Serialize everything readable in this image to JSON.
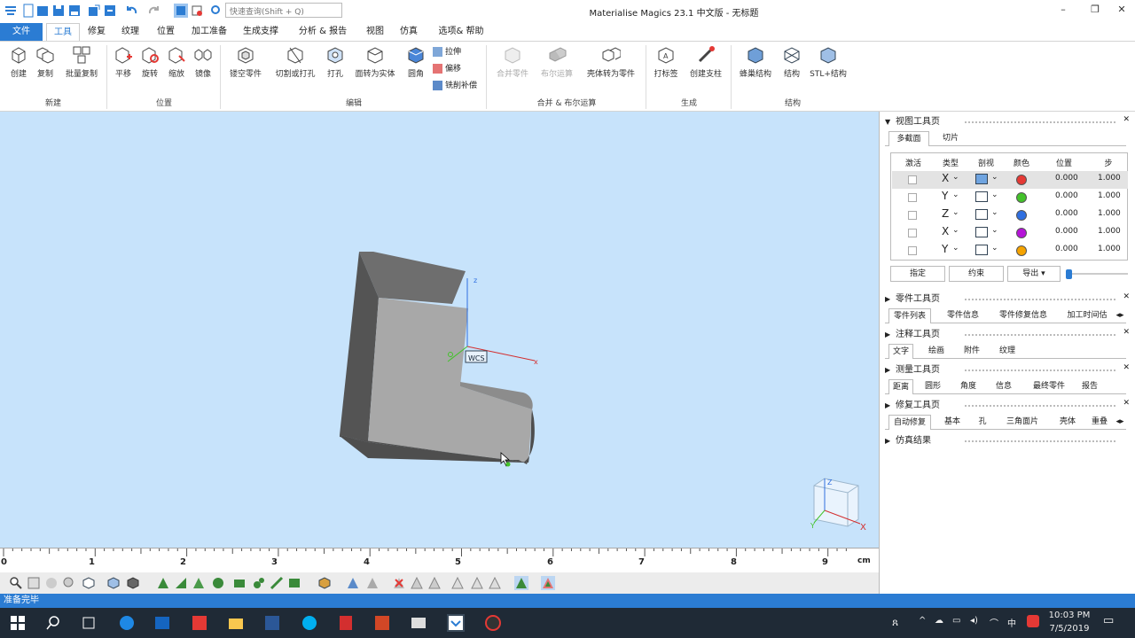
{
  "app": {
    "title": "Materialise Magics 23.1 中文版 - 无标题",
    "search_placeholder": "快速查询(Shift + Q)"
  },
  "ribbon_tabs": [
    "文件",
    "工具",
    "修复",
    "纹理",
    "位置",
    "加工准备",
    "生成支撑",
    "分析 & 报告",
    "视图",
    "仿真",
    "选项& 帮助"
  ],
  "ribbon": {
    "create": "创建",
    "copy": "复制",
    "batch_copy": "批量复制",
    "group_new": "新建",
    "translate": "平移",
    "rotate": "旋转",
    "scale": "缩放",
    "mirror": "镜像",
    "group_position": "位置",
    "hollow": "镂空零件",
    "cut_punch": "切割或打孔",
    "perforate": "打孔",
    "surface_to_solid": "面转为实体",
    "fillet": "圆角",
    "extrude": "拉伸",
    "offset": "偏移",
    "mill_comp": "铣削补偿",
    "group_edit": "编辑",
    "merge_parts": "合并零件",
    "boolean": "布尔运算",
    "shell_to_part": "壳体转为零件",
    "group_merge": "合并 & 布尔运算",
    "label": "打标签",
    "create_support": "创建支柱",
    "group_generate": "生成",
    "honeycomb": "蜂巢结构",
    "structure": "结构",
    "stl_structure": "STL+结构",
    "group_structure": "结构"
  },
  "viewport": {
    "wcs": "WCS",
    "z": "z",
    "x": "x",
    "ruler": [
      "0",
      "1",
      "2",
      "3",
      "4",
      "5",
      "6",
      "7",
      "8",
      "9"
    ],
    "unit": "cm"
  },
  "colors": {
    "accent": "#2b7cd3",
    "viewport_bg": "#c7e3fb",
    "part_front": "#a6a6a6",
    "part_side": "#5a5a5a",
    "part_top": "#6e6e6e"
  },
  "view_pages": {
    "title": "视图工具页",
    "tabs": [
      "多截面",
      "切片"
    ],
    "headers": [
      "激活",
      "类型",
      "剖视",
      "颜色",
      "位置",
      "步"
    ],
    "rows": [
      {
        "type": "X",
        "color": "#e53935",
        "pos": "0.000",
        "step": "1.000"
      },
      {
        "type": "Y",
        "color": "#43c22a",
        "pos": "0.000",
        "step": "1.000"
      },
      {
        "type": "Z",
        "color": "#2f6fe0",
        "pos": "0.000",
        "step": "1.000"
      },
      {
        "type": "X",
        "color": "#b514d8",
        "pos": "0.000",
        "step": "1.000"
      },
      {
        "type": "Y",
        "color": "#f5a300",
        "pos": "0.000",
        "step": "1.000"
      }
    ],
    "btn_assign": "指定",
    "btn_constraint": "约束",
    "btn_export": "导出"
  },
  "part_pages": {
    "title": "零件工具页",
    "tabs": [
      "零件列表",
      "零件信息",
      "零件修复信息",
      "加工时间估"
    ]
  },
  "annot_pages": {
    "title": "注释工具页",
    "tabs": [
      "文字",
      "绘画",
      "附件",
      "纹理"
    ]
  },
  "measure_pages": {
    "title": "测量工具页",
    "tabs": [
      "距离",
      "圆形",
      "角度",
      "信息",
      "最终零件",
      "报告"
    ]
  },
  "fix_pages": {
    "title": "修复工具页",
    "tabs": [
      "自动修复",
      "基本",
      "孔",
      "三角面片",
      "壳体",
      "重叠"
    ]
  },
  "sim_results": "仿真结果",
  "status": "准备完毕",
  "tray": {
    "time": "10:03 PM",
    "date": "7/5/2019",
    "ime": "中"
  }
}
